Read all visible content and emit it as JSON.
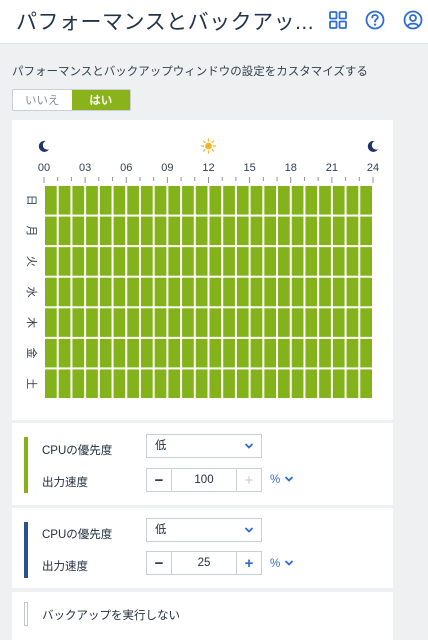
{
  "header": {
    "title": "パフォーマンスとバックアッ...",
    "icons": [
      "grid-icon",
      "help-icon",
      "account-icon"
    ]
  },
  "subtitle": "パフォーマンスとバックアップウィンドウの設定をカスタマイズする",
  "toggle": {
    "no_label": "いいえ",
    "yes_label": "はい",
    "selected": "はい"
  },
  "schedule": {
    "hours": [
      "00",
      "03",
      "06",
      "09",
      "12",
      "15",
      "18",
      "21",
      "24"
    ],
    "days": [
      "日",
      "月",
      "火",
      "水",
      "木",
      "金",
      "土"
    ],
    "hour_icons": [
      "moon-icon",
      "sun-icon",
      "moon-icon"
    ],
    "cell_color": "#84b21a"
  },
  "green_settings": {
    "color": "#84b21a",
    "cpu_label": "CPUの優先度",
    "cpu_value": "低",
    "speed_label": "出力速度",
    "speed_value": "100",
    "unit": "%"
  },
  "blue_settings": {
    "color": "#2b4f91",
    "cpu_label": "CPUの優先度",
    "cpu_value": "低",
    "speed_label": "出力速度",
    "speed_value": "25",
    "unit": "%"
  },
  "no_backup": {
    "color": "#c4c9cf",
    "label": "バックアップを実行しない"
  }
}
